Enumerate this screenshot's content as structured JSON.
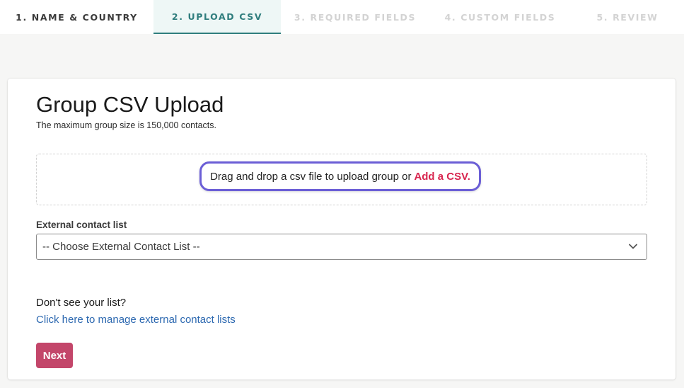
{
  "stepper": {
    "steps": [
      {
        "label": "1. NAME & COUNTRY",
        "state": "done"
      },
      {
        "label": "2. UPLOAD CSV",
        "state": "active"
      },
      {
        "label": "3. REQUIRED FIELDS",
        "state": "upcoming"
      },
      {
        "label": "4. CUSTOM FIELDS",
        "state": "upcoming"
      },
      {
        "label": "5. REVIEW",
        "state": "upcoming"
      }
    ]
  },
  "card": {
    "title": "Group CSV Upload",
    "subtitle": "The maximum group size is 150,000 contacts.",
    "dropzone": {
      "text": "Drag and drop a csv file to upload group or",
      "link_label": "Add a CSV."
    },
    "external_list": {
      "label": "External contact list",
      "selected": "-- Choose External Contact List --",
      "icon": "chevron-down-icon"
    },
    "help": {
      "question": "Don't see your list?",
      "link_label": "Click here to manage external contact lists"
    },
    "next_label": "Next"
  },
  "colors": {
    "active_step": "#2f7d7d",
    "highlight_border": "#6b5ed6",
    "add_link": "#d8264f",
    "manage_link": "#2c68b0",
    "next_button": "#c3466a"
  }
}
